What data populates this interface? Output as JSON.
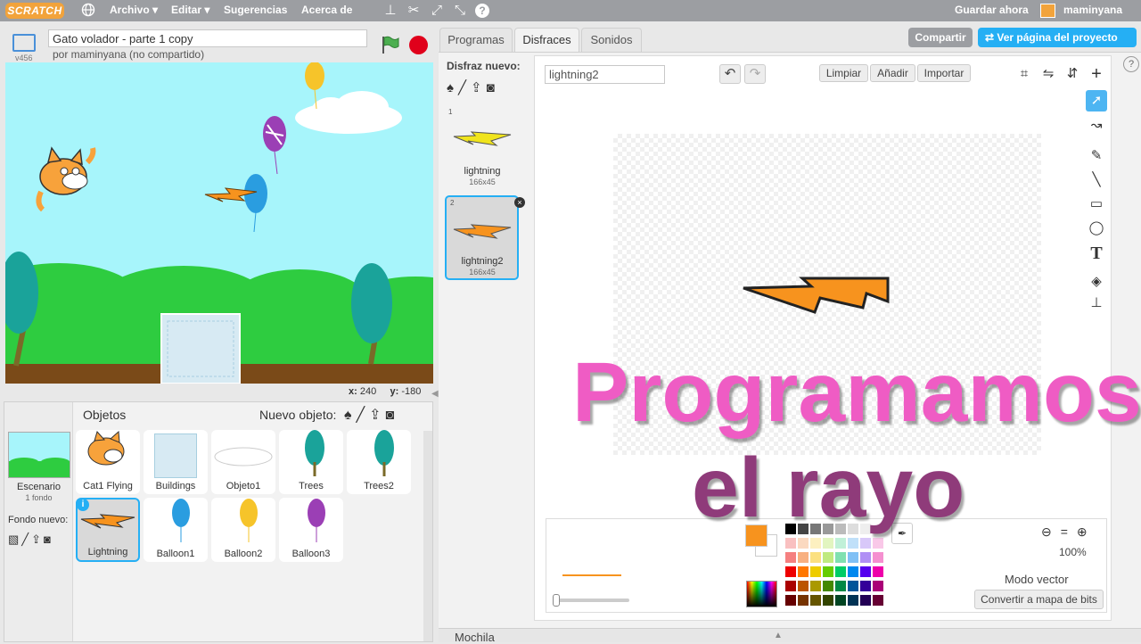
{
  "menubar": {
    "logo": "SCRATCH",
    "file": "Archivo ▾",
    "edit": "Editar ▾",
    "tips": "Sugerencias",
    "about": "Acerca de",
    "save_now": "Guardar ahora",
    "username": "maminyana"
  },
  "stage_header": {
    "version": "v456",
    "project_title": "Gato volador - parte 1 copy",
    "author": "por maminyana (no compartido)"
  },
  "stage_coords": {
    "x_label": "x:",
    "x_value": "240",
    "y_label": "y:",
    "y_value": "-180"
  },
  "sprites_pane": {
    "stage_label": "Escenario",
    "stage_sub": "1 fondo",
    "new_backdrop": "Fondo nuevo:",
    "objects_title": "Objetos",
    "new_object": "Nuevo objeto:",
    "sprites": [
      {
        "name": "Cat1 Flying"
      },
      {
        "name": "Buildings"
      },
      {
        "name": "Objeto1"
      },
      {
        "name": "Trees"
      },
      {
        "name": "Trees2"
      },
      {
        "name": "Lightning"
      },
      {
        "name": "Balloon1"
      },
      {
        "name": "Balloon2"
      },
      {
        "name": "Balloon3"
      }
    ]
  },
  "tabs": {
    "scripts": "Programas",
    "costumes": "Disfraces",
    "sounds": "Sonidos"
  },
  "share": {
    "share_label": "Compartir",
    "see_project": "Ver página del proyecto"
  },
  "costumes": {
    "new_costume": "Disfraz nuevo:",
    "list": [
      {
        "index": "1",
        "name": "lightning",
        "size": "166x45"
      },
      {
        "index": "2",
        "name": "lightning2",
        "size": "166x45"
      }
    ]
  },
  "paint_editor": {
    "costume_name": "lightning2",
    "clear": "Limpiar",
    "add": "Añadir",
    "import": "Importar",
    "zoom": "100%",
    "mode": "Modo vector",
    "convert": "Convertir a mapa de bits"
  },
  "overlay": {
    "line1": "Programamos",
    "line2": "el rayo"
  },
  "backpack": {
    "label": "Mochila"
  },
  "colors": {
    "topbar": "#9c9ea2",
    "accent_blue": "#25aff4",
    "overlay_pink": "#ef5cc4",
    "overlay_purple": "#8f3b7a",
    "bolt": "#f7931e",
    "fill_color": "#f7931e"
  }
}
